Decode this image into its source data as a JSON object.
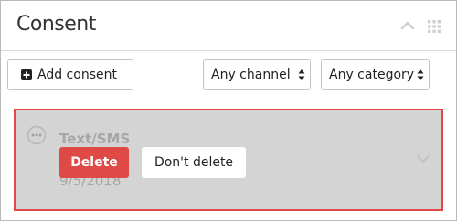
{
  "panel": {
    "title": "Consent"
  },
  "toolbar": {
    "add_label": "Add consent",
    "channel_select": {
      "selected": "Any channel"
    },
    "category_select": {
      "selected": "Any category"
    }
  },
  "consent_item": {
    "channel": "Text/SMS",
    "date": "9/5/2018",
    "confirm": {
      "delete_label": "Delete",
      "cancel_label": "Don't delete"
    }
  },
  "colors": {
    "danger": "#df4a47",
    "highlight_border": "#e0464a",
    "overlay": "#d4d4d4"
  },
  "icons": {
    "collapse": "chevron-up-icon",
    "drag": "grip-icon",
    "add": "plus-square-icon",
    "select": "updown-arrows-icon",
    "more": "ellipsis-circle-icon",
    "expand": "chevron-down-icon"
  }
}
